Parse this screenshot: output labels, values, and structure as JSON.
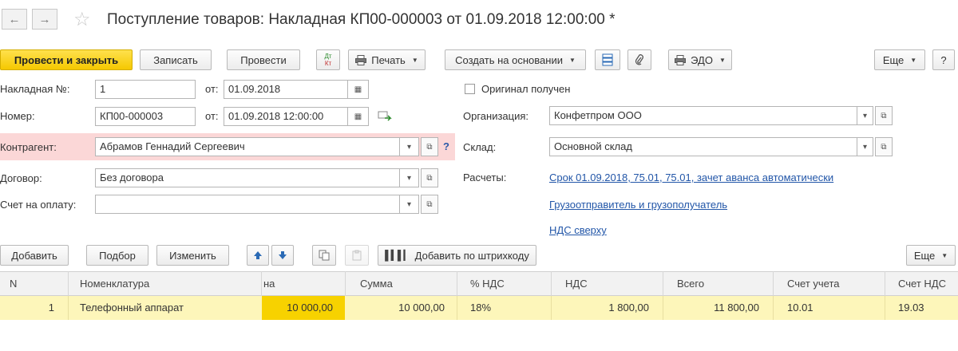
{
  "header": {
    "title": "Поступление товаров: Накладная КП00-000003 от 01.09.2018 12:00:00 *",
    "back_glyph": "←",
    "forward_glyph": "→",
    "star_glyph": "☆"
  },
  "toolbar": {
    "post_close": "Провести и закрыть",
    "save": "Записать",
    "post": "Провести",
    "dtkt_top": "Дт",
    "dtkt_bottom": "Кт",
    "print": "Печать",
    "create_based": "Создать на основании",
    "edo": "ЭДО",
    "more": "Еще",
    "help": "?"
  },
  "form": {
    "invoice_no_label": "Накладная №:",
    "invoice_no": "1",
    "from1_label": "от:",
    "invoice_date": "01.09.2018",
    "number_label": "Номер:",
    "number": "КП00-000003",
    "from2_label": "от:",
    "number_date": "01.09.2018 12:00:00",
    "counterparty_label": "Контрагент:",
    "counterparty": "Абрамов Геннадий Сергеевич",
    "question": "?",
    "contract_label": "Договор:",
    "contract": "Без договора",
    "payment_account_label": "Счет на оплату:",
    "payment_account": "",
    "original_received": "Оригинал получен",
    "organization_label": "Организация:",
    "organization": "Конфетпром ООО",
    "warehouse_label": "Склад:",
    "warehouse": "Основной склад",
    "settlements_label": "Расчеты:",
    "settlements_link": "Срок 01.09.2018, 75.01, 75.01, зачет аванса автоматически",
    "shipper_link": "Грузоотправитель и грузополучатель",
    "vat_link": "НДС сверху"
  },
  "table_toolbar": {
    "add": "Добавить",
    "select": "Подбор",
    "change": "Изменить",
    "barcode": "Добавить по штрихкоду",
    "more": "Еще"
  },
  "table": {
    "columns": [
      "N",
      "Номенклатура",
      "на",
      "Сумма",
      "% НДС",
      "НДС",
      "Всего",
      "Счет учета",
      "Счет НДС"
    ],
    "rows": [
      {
        "n": "1",
        "item": "Телефонный аппарат",
        "price": "10 000,00",
        "sum": "10 000,00",
        "vat_rate": "18%",
        "vat": "1 800,00",
        "total": "11 800,00",
        "account": "10.01",
        "vat_account": "19.03"
      }
    ]
  }
}
